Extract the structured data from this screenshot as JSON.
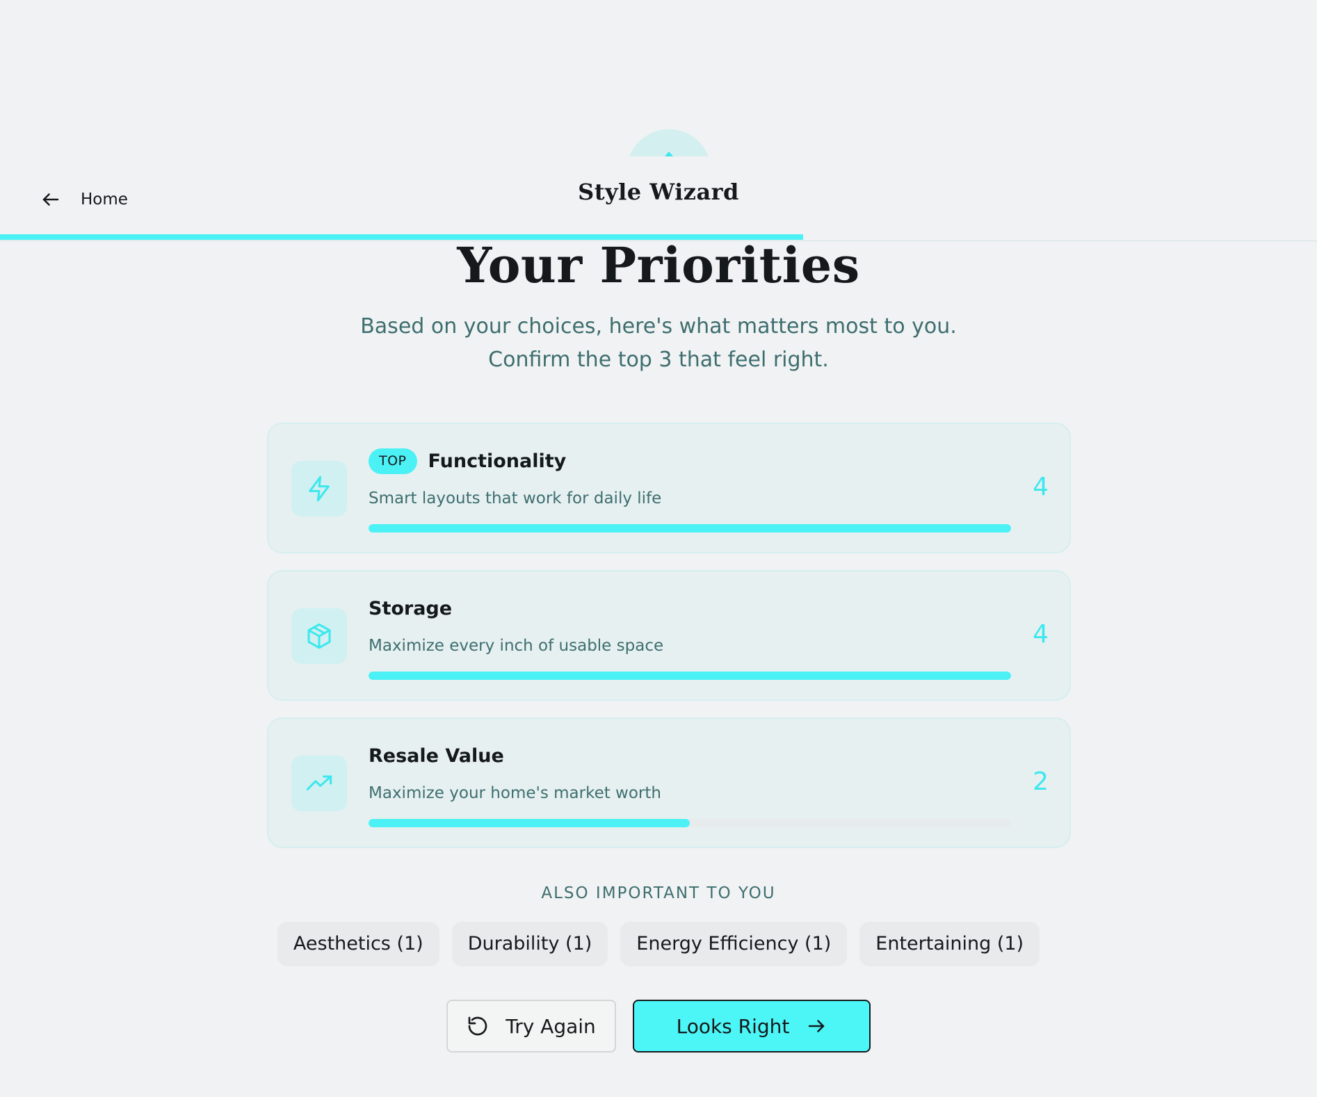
{
  "header": {
    "back_label": "Home",
    "title": "Style Wizard",
    "progress_percent": 61
  },
  "main": {
    "title": "Your Priorities",
    "subtitle_line1": "Based on your choices, here's what matters most to you.",
    "subtitle_line2": "Confirm the top 3 that feel right."
  },
  "priorities": [
    {
      "badge": "TOP",
      "title": "Functionality",
      "description": "Smart layouts that work for daily life",
      "score": "4",
      "fill_percent": 100,
      "icon": "lightning-icon"
    },
    {
      "title": "Storage",
      "description": "Maximize every inch of usable space",
      "score": "4",
      "fill_percent": 100,
      "icon": "box-icon"
    },
    {
      "title": "Resale Value",
      "description": "Maximize your home's market worth",
      "score": "2",
      "fill_percent": 50,
      "icon": "trending-up-icon"
    }
  ],
  "also_important": {
    "heading": "ALSO IMPORTANT TO YOU",
    "items": [
      "Aesthetics (1)",
      "Durability (1)",
      "Energy Efficiency (1)",
      "Entertaining (1)"
    ]
  },
  "actions": {
    "try_again": "Try Again",
    "looks_right": "Looks Right"
  },
  "colors": {
    "accent": "#4cf1f5",
    "background": "#f1f2f3",
    "text_muted": "#3d6e6f"
  }
}
